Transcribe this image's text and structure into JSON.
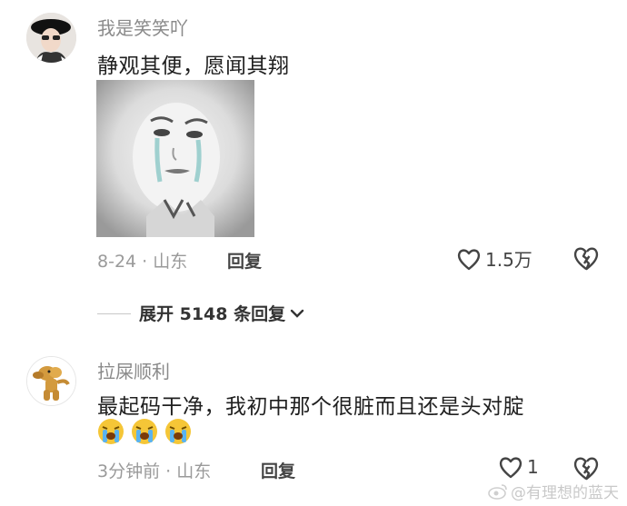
{
  "comments": [
    {
      "username": "我是笑笑吖",
      "text": "静观其便，愿闻其翔",
      "meta": "8-24 · 山东",
      "reply_label": "回复",
      "like_count": "1.5万"
    },
    {
      "username": "拉屎顺利",
      "text": "最起码干净，我初中那个很脏而且还是头对腚",
      "meta": "3分钟前 · 山东",
      "reply_label": "回复",
      "like_count": "1"
    }
  ],
  "expand_replies": "展开 5148 条回复",
  "watermark": "@有理想的蓝天",
  "icons": {
    "like": "heart-outline-icon",
    "dislike": "broken-heart-icon",
    "expand": "chevron-down-icon",
    "emoji": "loudly-crying-face-icon",
    "weibo": "weibo-logo-icon"
  },
  "colors": {
    "username": "#8a8a8a",
    "text": "#202020",
    "meta": "#9a9a9a"
  }
}
